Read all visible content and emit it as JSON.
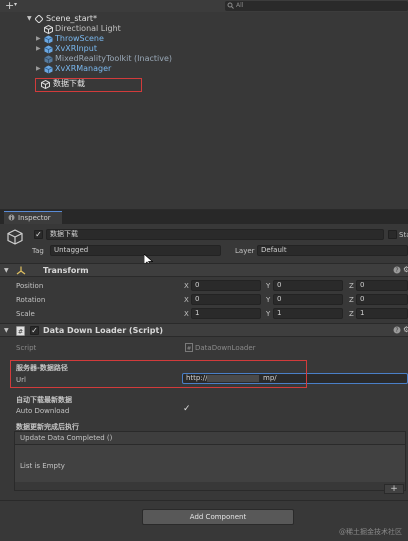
{
  "colors": {
    "panel_bg": "#383838",
    "field_bg": "#2a2a2a",
    "header_bg": "#3e3e3e",
    "prefab_blue": "#7ab8ef",
    "highlight_red": "#d23b3b",
    "tab_accent": "#5a8bd6"
  },
  "hierarchy": {
    "add_button": "+",
    "add_dropdown": "▾",
    "search_text": "All",
    "search_icon": "search-icon",
    "scene_name": "Scene_start*",
    "items": [
      {
        "label": "Directional Light",
        "icon": "gameobject-icon",
        "style": "normal",
        "expandable": false
      },
      {
        "label": "ThrowScene",
        "icon": "prefab-icon",
        "style": "prefab",
        "expandable": true
      },
      {
        "label": "XvXRInput",
        "icon": "prefab-icon",
        "style": "prefab",
        "expandable": true
      },
      {
        "label": "MixedRealityToolkit (Inactive)",
        "icon": "prefab-icon",
        "style": "inactive",
        "expandable": false
      },
      {
        "label": "XvXRManager",
        "icon": "prefab-icon",
        "style": "prefab",
        "expandable": true
      },
      {
        "label": "数据下载",
        "icon": "gameobject-icon",
        "style": "selected",
        "expandable": false
      }
    ]
  },
  "inspector": {
    "tab_label": "Inspector",
    "object_name": "数据下载",
    "active": true,
    "static_label": "Sta",
    "tag_label": "Tag",
    "tag_value": "Untagged",
    "layer_label": "Layer",
    "layer_value": "Default",
    "transform": {
      "title": "Transform",
      "rows": [
        {
          "label": "Position",
          "x": "0",
          "y": "0",
          "z": "0"
        },
        {
          "label": "Rotation",
          "x": "0",
          "y": "0",
          "z": "0"
        },
        {
          "label": "Scale",
          "x": "1",
          "y": "1",
          "z": "1"
        }
      ],
      "axis_x": "X",
      "axis_y": "Y",
      "axis_z": "Z"
    },
    "script_component": {
      "title": "Data Down Loader (Script)",
      "enabled": true,
      "script_label": "Script",
      "script_value": "DataDownLoader",
      "section_path": "服务器-数据路径",
      "url_label": "Url",
      "url_value_prefix": "http://",
      "url_value_suffix": "mp/",
      "section_auto": "自动下载最新数据",
      "auto_label": "Auto Download",
      "auto_checked": true,
      "section_event": "数据更新完成后执行",
      "event_title": "Update Data Completed ()",
      "event_empty": "List is Empty",
      "add_listener": "+"
    },
    "add_component": "Add Component",
    "watermark": "@稀土掘金技术社区"
  }
}
